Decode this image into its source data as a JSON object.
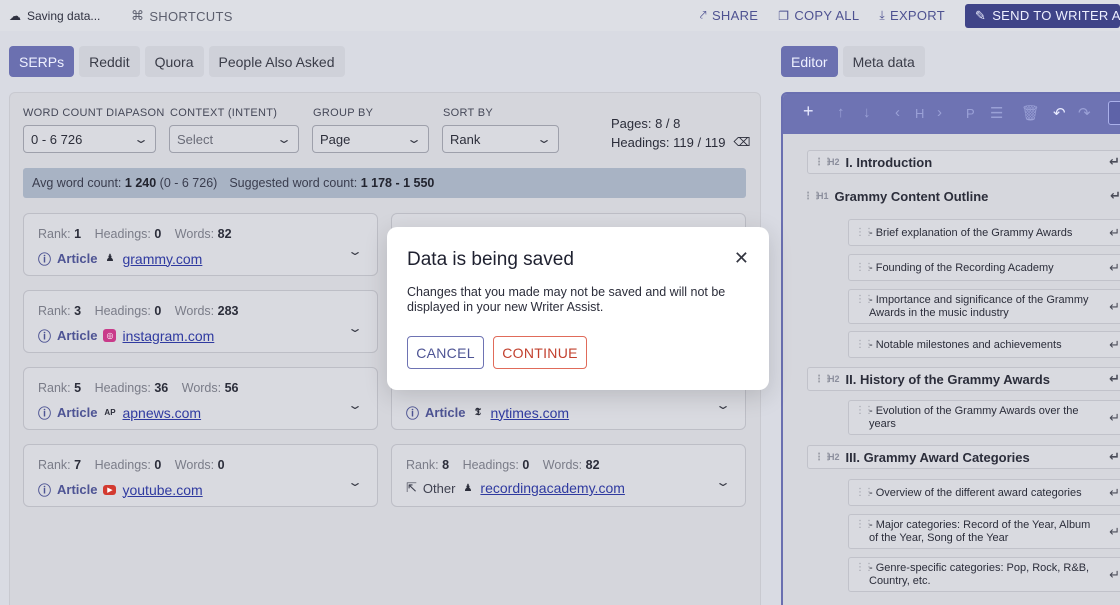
{
  "topbar": {
    "saving": "Saving data...",
    "shortcuts": "SHORTCUTS",
    "share": "SHARE",
    "copy_all": "COPY ALL",
    "export": "EXPORT",
    "send": "SEND TO WRITER ASS"
  },
  "left_tabs": [
    "SERPs",
    "Reddit",
    "Quora",
    "People Also Asked"
  ],
  "filters": {
    "word_count_label": "WORD COUNT DIAPASON",
    "word_count_value": "0 - 6 726",
    "context_label": "CONTEXT (INTENT)",
    "context_placeholder": "Select",
    "group_by_label": "GROUP BY",
    "group_by_value": "Page",
    "sort_by_label": "SORT BY",
    "sort_by_value": "Rank",
    "pages": "Pages: 8 / 8",
    "headings": "Headings: 119 / 119"
  },
  "infobar": {
    "avg_label": "Avg word count:",
    "avg_value": "1 240",
    "avg_range": "(0 - 6 726)",
    "suggested_label": "Suggested word count:",
    "suggested_value": "1 178 - 1 550"
  },
  "labels": {
    "rank": "Rank:",
    "headings": "Headings:",
    "words": "Words:"
  },
  "results": [
    {
      "rank": "1",
      "headings": "0",
      "words": "82",
      "type": "Article",
      "site": "grammy.com"
    },
    {
      "rank": "3",
      "headings": "0",
      "words": "283",
      "type": "Article",
      "site": "instagram.com"
    },
    {
      "rank": "5",
      "headings": "36",
      "words": "56",
      "type": "Article",
      "site": "apnews.com"
    },
    {
      "type": "Article",
      "site": "nytimes.com"
    },
    {
      "rank": "7",
      "headings": "0",
      "words": "0",
      "type": "Article",
      "site": "youtube.com"
    },
    {
      "rank": "8",
      "headings": "0",
      "words": "82",
      "type": "Other",
      "site": "recordingacademy.com"
    }
  ],
  "right_tabs": [
    "Editor",
    "Meta data"
  ],
  "outline": [
    {
      "level": "H2",
      "text": "I. Introduction"
    },
    {
      "level": "H1",
      "text": "Grammy Content Outline"
    },
    {
      "level": "",
      "text": "- Brief explanation of the Grammy Awards"
    },
    {
      "level": "",
      "text": "- Founding of the Recording Academy"
    },
    {
      "level": "",
      "text": "- Importance and significance of the Grammy Awards in the music industry"
    },
    {
      "level": "",
      "text": "- Notable milestones and achievements"
    },
    {
      "level": "H2",
      "text": "II. History of the Grammy Awards"
    },
    {
      "level": "",
      "text": "- Evolution of the Grammy Awards over the years"
    },
    {
      "level": "H2",
      "text": "III. Grammy Award Categories"
    },
    {
      "level": "",
      "text": "- Overview of the different award categories"
    },
    {
      "level": "",
      "text": "- Major categories: Record of the Year, Album of the Year, Song of the Year"
    },
    {
      "level": "",
      "text": "- Genre-specific categories: Pop, Rock, R&B, Country, etc."
    }
  ],
  "modal": {
    "title": "Data is being saved",
    "body": "Changes that you made may not be saved and will not be displayed in your new Writer Assist.",
    "cancel": "CANCEL",
    "continue": "CONTINUE"
  }
}
